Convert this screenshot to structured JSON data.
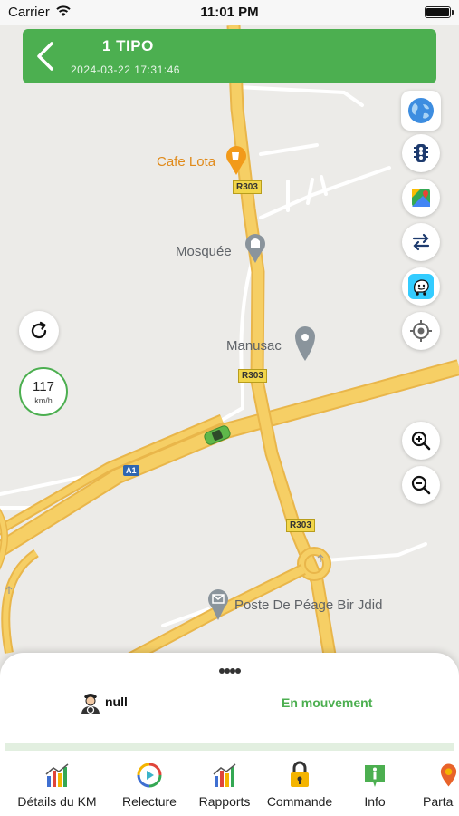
{
  "status_bar": {
    "carrier": "Carrier",
    "time": "11:01 PM"
  },
  "header": {
    "vehicle_name": "1 TIPO",
    "datetime": "2024-03-22 17:31:46"
  },
  "map": {
    "places": {
      "cafe": "Cafe Lota",
      "mosque": "Mosquée",
      "manusac": "Manusac",
      "toll": "Poste De Péage Bir Jdid"
    },
    "road_shields": {
      "r303_a": "R303",
      "r303_b": "R303",
      "r303_c": "R303",
      "a1": "A1"
    }
  },
  "speed": {
    "value": "117",
    "unit": "km/h"
  },
  "bottom_sheet": {
    "driver_name": "null",
    "state": "En mouvement"
  },
  "tabs": [
    {
      "label": "Détails du KM"
    },
    {
      "label": "Relecture"
    },
    {
      "label": "Rapports"
    },
    {
      "label": "Commande"
    },
    {
      "label": "Info"
    },
    {
      "label": "Parta"
    }
  ],
  "colors": {
    "accent": "#4caf50",
    "road": "#f6cf65",
    "map_bg": "#ecebe8"
  }
}
